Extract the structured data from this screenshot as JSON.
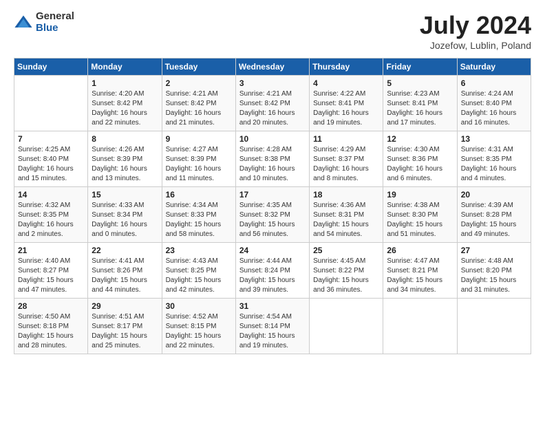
{
  "logo": {
    "general": "General",
    "blue": "Blue"
  },
  "title": "July 2024",
  "subtitle": "Jozefow, Lublin, Poland",
  "days_header": [
    "Sunday",
    "Monday",
    "Tuesday",
    "Wednesday",
    "Thursday",
    "Friday",
    "Saturday"
  ],
  "weeks": [
    [
      {
        "day": "",
        "detail": ""
      },
      {
        "day": "1",
        "detail": "Sunrise: 4:20 AM\nSunset: 8:42 PM\nDaylight: 16 hours\nand 22 minutes."
      },
      {
        "day": "2",
        "detail": "Sunrise: 4:21 AM\nSunset: 8:42 PM\nDaylight: 16 hours\nand 21 minutes."
      },
      {
        "day": "3",
        "detail": "Sunrise: 4:21 AM\nSunset: 8:42 PM\nDaylight: 16 hours\nand 20 minutes."
      },
      {
        "day": "4",
        "detail": "Sunrise: 4:22 AM\nSunset: 8:41 PM\nDaylight: 16 hours\nand 19 minutes."
      },
      {
        "day": "5",
        "detail": "Sunrise: 4:23 AM\nSunset: 8:41 PM\nDaylight: 16 hours\nand 17 minutes."
      },
      {
        "day": "6",
        "detail": "Sunrise: 4:24 AM\nSunset: 8:40 PM\nDaylight: 16 hours\nand 16 minutes."
      }
    ],
    [
      {
        "day": "7",
        "detail": "Sunrise: 4:25 AM\nSunset: 8:40 PM\nDaylight: 16 hours\nand 15 minutes."
      },
      {
        "day": "8",
        "detail": "Sunrise: 4:26 AM\nSunset: 8:39 PM\nDaylight: 16 hours\nand 13 minutes."
      },
      {
        "day": "9",
        "detail": "Sunrise: 4:27 AM\nSunset: 8:39 PM\nDaylight: 16 hours\nand 11 minutes."
      },
      {
        "day": "10",
        "detail": "Sunrise: 4:28 AM\nSunset: 8:38 PM\nDaylight: 16 hours\nand 10 minutes."
      },
      {
        "day": "11",
        "detail": "Sunrise: 4:29 AM\nSunset: 8:37 PM\nDaylight: 16 hours\nand 8 minutes."
      },
      {
        "day": "12",
        "detail": "Sunrise: 4:30 AM\nSunset: 8:36 PM\nDaylight: 16 hours\nand 6 minutes."
      },
      {
        "day": "13",
        "detail": "Sunrise: 4:31 AM\nSunset: 8:35 PM\nDaylight: 16 hours\nand 4 minutes."
      }
    ],
    [
      {
        "day": "14",
        "detail": "Sunrise: 4:32 AM\nSunset: 8:35 PM\nDaylight: 16 hours\nand 2 minutes."
      },
      {
        "day": "15",
        "detail": "Sunrise: 4:33 AM\nSunset: 8:34 PM\nDaylight: 16 hours\nand 0 minutes."
      },
      {
        "day": "16",
        "detail": "Sunrise: 4:34 AM\nSunset: 8:33 PM\nDaylight: 15 hours\nand 58 minutes."
      },
      {
        "day": "17",
        "detail": "Sunrise: 4:35 AM\nSunset: 8:32 PM\nDaylight: 15 hours\nand 56 minutes."
      },
      {
        "day": "18",
        "detail": "Sunrise: 4:36 AM\nSunset: 8:31 PM\nDaylight: 15 hours\nand 54 minutes."
      },
      {
        "day": "19",
        "detail": "Sunrise: 4:38 AM\nSunset: 8:30 PM\nDaylight: 15 hours\nand 51 minutes."
      },
      {
        "day": "20",
        "detail": "Sunrise: 4:39 AM\nSunset: 8:28 PM\nDaylight: 15 hours\nand 49 minutes."
      }
    ],
    [
      {
        "day": "21",
        "detail": "Sunrise: 4:40 AM\nSunset: 8:27 PM\nDaylight: 15 hours\nand 47 minutes."
      },
      {
        "day": "22",
        "detail": "Sunrise: 4:41 AM\nSunset: 8:26 PM\nDaylight: 15 hours\nand 44 minutes."
      },
      {
        "day": "23",
        "detail": "Sunrise: 4:43 AM\nSunset: 8:25 PM\nDaylight: 15 hours\nand 42 minutes."
      },
      {
        "day": "24",
        "detail": "Sunrise: 4:44 AM\nSunset: 8:24 PM\nDaylight: 15 hours\nand 39 minutes."
      },
      {
        "day": "25",
        "detail": "Sunrise: 4:45 AM\nSunset: 8:22 PM\nDaylight: 15 hours\nand 36 minutes."
      },
      {
        "day": "26",
        "detail": "Sunrise: 4:47 AM\nSunset: 8:21 PM\nDaylight: 15 hours\nand 34 minutes."
      },
      {
        "day": "27",
        "detail": "Sunrise: 4:48 AM\nSunset: 8:20 PM\nDaylight: 15 hours\nand 31 minutes."
      }
    ],
    [
      {
        "day": "28",
        "detail": "Sunrise: 4:50 AM\nSunset: 8:18 PM\nDaylight: 15 hours\nand 28 minutes."
      },
      {
        "day": "29",
        "detail": "Sunrise: 4:51 AM\nSunset: 8:17 PM\nDaylight: 15 hours\nand 25 minutes."
      },
      {
        "day": "30",
        "detail": "Sunrise: 4:52 AM\nSunset: 8:15 PM\nDaylight: 15 hours\nand 22 minutes."
      },
      {
        "day": "31",
        "detail": "Sunrise: 4:54 AM\nSunset: 8:14 PM\nDaylight: 15 hours\nand 19 minutes."
      },
      {
        "day": "",
        "detail": ""
      },
      {
        "day": "",
        "detail": ""
      },
      {
        "day": "",
        "detail": ""
      }
    ]
  ]
}
